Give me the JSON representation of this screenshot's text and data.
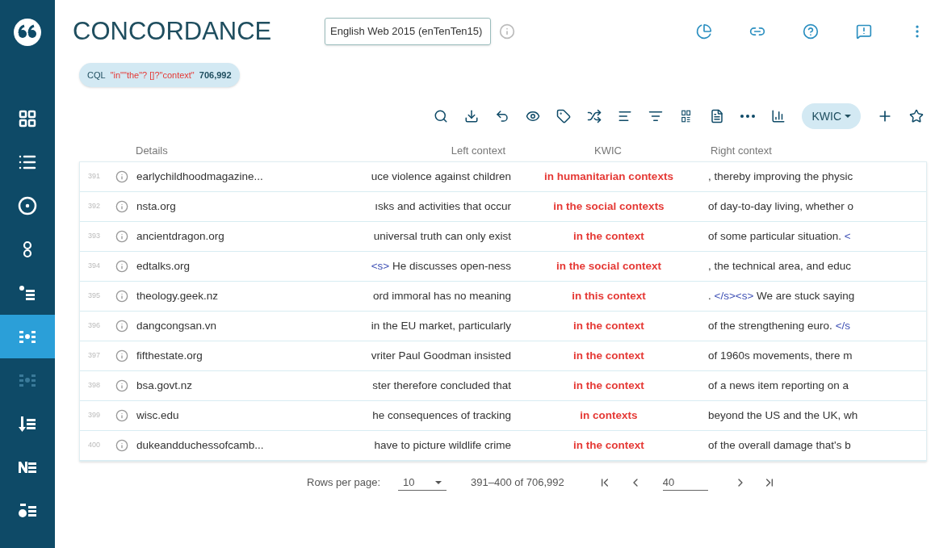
{
  "sidebar": {
    "items": [
      {
        "selected": false,
        "disabled": false
      },
      {
        "selected": false,
        "disabled": false
      },
      {
        "selected": false,
        "disabled": false
      },
      {
        "selected": false,
        "disabled": false
      },
      {
        "selected": false,
        "disabled": false
      },
      {
        "selected": true,
        "disabled": false
      },
      {
        "selected": false,
        "disabled": true
      },
      {
        "selected": false,
        "disabled": false
      },
      {
        "selected": false,
        "disabled": false
      },
      {
        "selected": false,
        "disabled": false
      }
    ]
  },
  "header": {
    "title": "CONCORDANCE",
    "corpus": "English Web 2015 (enTenTen15)"
  },
  "query": {
    "label": "CQL",
    "cql": "\"in\"\"the\"? []?\"context\"",
    "count": "706,992"
  },
  "toolbar": {
    "view": "KWIC"
  },
  "table": {
    "columns": [
      "Details",
      "Left context",
      "KWIC",
      "Right context"
    ],
    "rows": [
      {
        "num": "391",
        "details": "earlychildhoodmagazine...",
        "left": [
          {
            "kind": "text",
            "text": "uce violence against children"
          }
        ],
        "kwic": "in humanitarian contexts",
        "right": [
          {
            "kind": "text",
            "text": ", thereby improving the physic"
          }
        ]
      },
      {
        "num": "392",
        "details": "nsta.org",
        "left": [
          {
            "kind": "text",
            "text": "ısks and activities that occur"
          }
        ],
        "kwic": "in the social contexts",
        "right": [
          {
            "kind": "text",
            "text": "of day-to-day living, whether o"
          }
        ]
      },
      {
        "num": "393",
        "details": "ancientdragon.org",
        "left": [
          {
            "kind": "text",
            "text": "universal truth can only exist"
          }
        ],
        "kwic": "in the context",
        "right": [
          {
            "kind": "text",
            "text": "of some particular situation. "
          },
          {
            "kind": "tag",
            "text": "<"
          }
        ]
      },
      {
        "num": "394",
        "details": "edtalks.org",
        "left": [
          {
            "kind": "tag",
            "text": "<s>"
          },
          {
            "kind": "text",
            "text": " He discusses open-ness"
          }
        ],
        "kwic": "in the social context",
        "right": [
          {
            "kind": "text",
            "text": ", the technical area, and educ"
          }
        ]
      },
      {
        "num": "395",
        "details": "theology.geek.nz",
        "left": [
          {
            "kind": "text",
            "text": "ord immoral has no meaning"
          }
        ],
        "kwic": "in this context",
        "right": [
          {
            "kind": "text",
            "text": ". "
          },
          {
            "kind": "tag",
            "text": "</s><s>"
          },
          {
            "kind": "text",
            "text": " We are stuck saying"
          }
        ]
      },
      {
        "num": "396",
        "details": "dangcongsan.vn",
        "left": [
          {
            "kind": "text",
            "text": "in the EU market, particularly"
          }
        ],
        "kwic": "in the context",
        "right": [
          {
            "kind": "text",
            "text": "of the strengthening euro. "
          },
          {
            "kind": "tag",
            "text": "</s"
          }
        ]
      },
      {
        "num": "397",
        "details": "fifthestate.org",
        "left": [
          {
            "kind": "text",
            "text": "vriter Paul Goodman insisted"
          }
        ],
        "kwic": "in the context",
        "right": [
          {
            "kind": "text",
            "text": "of 1960s movements, there m"
          }
        ]
      },
      {
        "num": "398",
        "details": "bsa.govt.nz",
        "left": [
          {
            "kind": "text",
            "text": "ster therefore concluded that"
          }
        ],
        "kwic": "in the context",
        "right": [
          {
            "kind": "text",
            "text": "of a news item reporting on a"
          }
        ]
      },
      {
        "num": "399",
        "details": "wisc.edu",
        "left": [
          {
            "kind": "text",
            "text": "he consequences of tracking"
          }
        ],
        "kwic": "in contexts",
        "right": [
          {
            "kind": "text",
            "text": "beyond the US and the UK, wh"
          }
        ]
      },
      {
        "num": "400",
        "details": "dukeandduchessofcamb...",
        "left": [
          {
            "kind": "text",
            "text": "have to picture wildlife crime"
          }
        ],
        "kwic": "in the context",
        "right": [
          {
            "kind": "text",
            "text": "of the overall damage that's b"
          }
        ]
      }
    ]
  },
  "pagination": {
    "rows_label": "Rows per page:",
    "rows_value": "10",
    "range": "391–400 of 706,992",
    "page": "40"
  }
}
